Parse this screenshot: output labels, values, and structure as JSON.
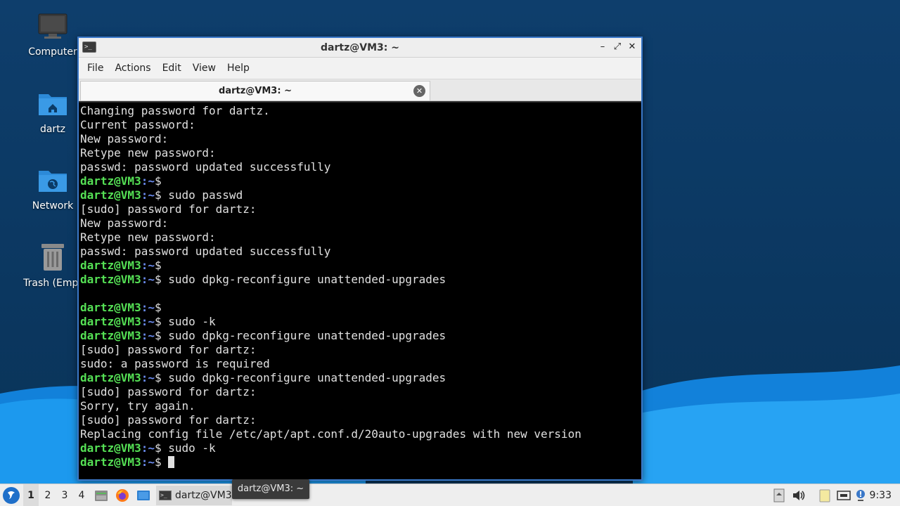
{
  "desktop": {
    "icons": [
      {
        "label": "Computer",
        "icon": "computer-icon"
      },
      {
        "label": "dartz",
        "icon": "home-folder-icon"
      },
      {
        "label": "Network",
        "icon": "network-folder-icon"
      },
      {
        "label": "Trash (Empt",
        "icon": "trash-icon"
      }
    ]
  },
  "window": {
    "title": "dartz@VM3: ~",
    "controls": {
      "minimize": "–",
      "maximize": "⤢",
      "close": "✕"
    },
    "menu": [
      "File",
      "Actions",
      "Edit",
      "View",
      "Help"
    ],
    "tab": {
      "label": "dartz@VM3: ~",
      "close": "✕"
    }
  },
  "terminal": {
    "prompt_user": "dartz@VM3",
    "prompt_path": ":~",
    "prompt_symbol": "$ ",
    "lines": [
      {
        "type": "out",
        "text": "Changing password for dartz."
      },
      {
        "type": "out",
        "text": "Current password:"
      },
      {
        "type": "out",
        "text": "New password:"
      },
      {
        "type": "out",
        "text": "Retype new password:"
      },
      {
        "type": "out",
        "text": "passwd: password updated successfully"
      },
      {
        "type": "prompt",
        "text": ""
      },
      {
        "type": "prompt",
        "text": "sudo passwd"
      },
      {
        "type": "out",
        "text": "[sudo] password for dartz:"
      },
      {
        "type": "out",
        "text": "New password:"
      },
      {
        "type": "out",
        "text": "Retype new password:"
      },
      {
        "type": "out",
        "text": "passwd: password updated successfully"
      },
      {
        "type": "prompt",
        "text": ""
      },
      {
        "type": "prompt",
        "text": "sudo dpkg-reconfigure unattended-upgrades"
      },
      {
        "type": "out",
        "text": ""
      },
      {
        "type": "prompt",
        "text": ""
      },
      {
        "type": "prompt",
        "text": "sudo -k"
      },
      {
        "type": "prompt",
        "text": "sudo dpkg-reconfigure unattended-upgrades"
      },
      {
        "type": "out",
        "text": "[sudo] password for dartz:"
      },
      {
        "type": "out",
        "text": "sudo: a password is required"
      },
      {
        "type": "prompt",
        "text": "sudo dpkg-reconfigure unattended-upgrades"
      },
      {
        "type": "out",
        "text": "[sudo] password for dartz:"
      },
      {
        "type": "out",
        "text": "Sorry, try again."
      },
      {
        "type": "out",
        "text": "[sudo] password for dartz:"
      },
      {
        "type": "out",
        "text": "Replacing config file /etc/apt/apt.conf.d/20auto-upgrades with new version"
      },
      {
        "type": "prompt",
        "text": "sudo -k"
      },
      {
        "type": "prompt",
        "text": "",
        "cursor": true
      }
    ]
  },
  "taskbar": {
    "workspaces": [
      "1",
      "2",
      "3",
      "4"
    ],
    "active_workspace": "1",
    "task_label": "dartz@VM3",
    "tooltip": "dartz@VM3: ~",
    "clock": "9:33"
  },
  "colors": {
    "prompt_user": "#55e055",
    "prompt_path": "#6b8cf0",
    "accent": "#3a78c8"
  }
}
